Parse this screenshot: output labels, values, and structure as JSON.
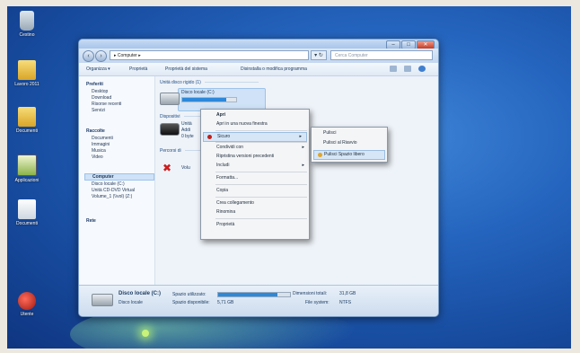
{
  "desktop": {
    "icons": [
      {
        "label": "Cestino"
      },
      {
        "label": "Lavoro 2011"
      },
      {
        "label": "Documenti"
      },
      {
        "label": "Applicazioni"
      },
      {
        "label": "Documenti"
      },
      {
        "label": "Utente"
      }
    ]
  },
  "window": {
    "controls": {
      "minimize": "–",
      "maximize": "□",
      "close": "✕"
    },
    "address": {
      "back": "‹",
      "forward": "›",
      "path": "▸ Computer ▸",
      "refresh": "▾ ↻"
    },
    "search": {
      "placeholder": "Cerca Computer"
    },
    "toolbar": {
      "organize": "Organizza ▾",
      "properties": "Proprietà",
      "system_properties": "Proprietà del sistema",
      "uninstall": "Disinstalla o modifica programma"
    },
    "nav": {
      "favorites": {
        "label": "Preferiti",
        "items": [
          "Desktop",
          "Download",
          "Risorse recenti",
          "Servizi"
        ]
      },
      "libraries": {
        "label": "Raccolte",
        "items": [
          "Documenti",
          "Immagini",
          "Musica",
          "Video"
        ]
      },
      "computer": {
        "label": "Computer",
        "items": [
          "Disco locale (C:)",
          "Unità CD-DVD Virtual",
          "Volume_1 (\\\\vol) (Z:)"
        ]
      },
      "network": {
        "label": "Rete"
      }
    },
    "content": {
      "hdd_section": "Unità disco rigido (1)",
      "drive_c": {
        "name": "Disco locale (C:)",
        "free_text": "",
        "used_fraction": 0.82
      },
      "removable_section": "Dispositivi",
      "dvd": {
        "name": "Unità",
        "line2": "Addi",
        "line3": "0 byte"
      },
      "network_section": "Percorsi di",
      "net_drive": {
        "name": "Volu"
      }
    },
    "details": {
      "name": "Disco locale (C:)",
      "type": "Disco locale",
      "used_label": "Spazio utilizzato:",
      "free_label": "Spazio disponibile:",
      "free_value": "5,71 GB",
      "total_label": "Dimensioni totali:",
      "total_value": "31,8 GB",
      "fs_label": "File system:",
      "fs_value": "NTFS",
      "used_fraction": 0.82
    }
  },
  "context_menu": {
    "items": [
      {
        "label": "Apri",
        "bold": true
      },
      {
        "label": "Apri in una nuova finestra"
      },
      {
        "label": "Sicuro",
        "arrow": "▸",
        "highlight": true
      },
      {
        "label": "Condividi con",
        "arrow": "▸"
      },
      {
        "label": "Ripristina versioni precedenti"
      },
      {
        "label": "Includi",
        "arrow": "▸"
      },
      {
        "label": "Formatta..."
      },
      {
        "label": "Copia"
      },
      {
        "label": "Crea collegamento"
      },
      {
        "label": "Rinomina"
      },
      {
        "label": "Proprietà"
      }
    ],
    "submenu": [
      {
        "label": "Pulisci"
      },
      {
        "label": "Pulisci al Riavvio"
      },
      {
        "label": "Pulisci Spazio libero",
        "highlight": true
      }
    ]
  },
  "colors": {
    "accent": "#2c88d9",
    "menu_highlight": "#d6e6f7",
    "desktop": "#2565bf"
  }
}
